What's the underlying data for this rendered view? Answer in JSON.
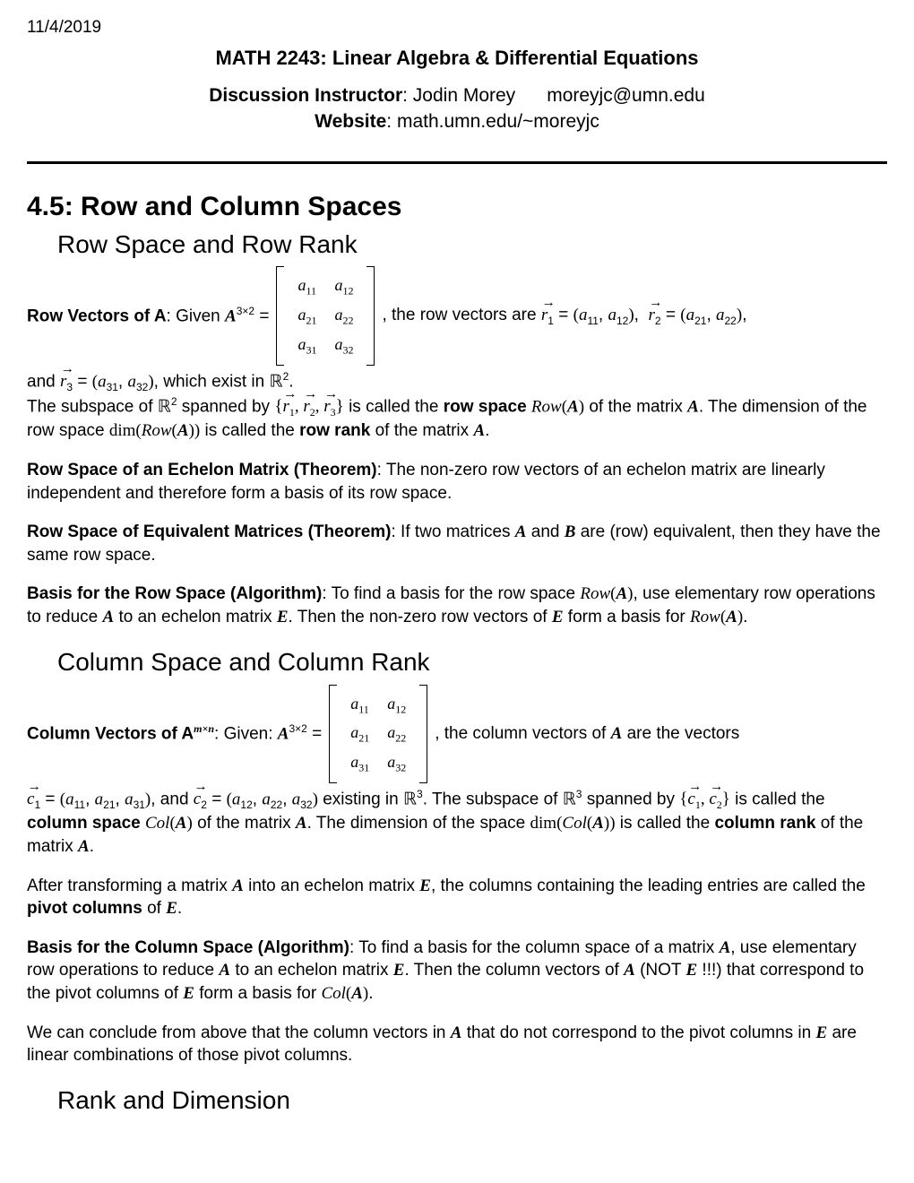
{
  "date": "11/4/2019",
  "course_title": "MATH 2243: Linear Algebra & Differential Equations",
  "instructor_label": "Discussion Instructor",
  "instructor_name": "Jodin Morey",
  "instructor_email": "moreyjc@umn.edu",
  "website_label": "Website",
  "website": "math.umn.edu/~moreyjc",
  "section_number": "4.5:",
  "section_title": "Row and Column Spaces",
  "sub1": "Row Space and Row Rank",
  "rowvec_label": "Row Vectors of A",
  "rowvec_given": ": Given ",
  "rowvec_post": ", the row vectors are ",
  "rowvec_and": "and  ",
  "rowvec_exist": " which exist in ",
  "rowspace_span_pre": "The subspace of ",
  "rowspace_span_mid": " spanned by ",
  "rowspace_span_post": " is called the ",
  "rowspace_bold": "row space",
  "rowspace_of": " of the matrix ",
  "rowspace_dim_pre": " The dimension of the row space ",
  "rowspace_dim_post": " is called the ",
  "rowrank_bold": "row rank",
  "rowrank_of": " of the matrix ",
  "echelon_title": "Row Space of an Echelon Matrix (Theorem)",
  "echelon_body": ":  The non-zero row vectors of an echelon matrix are linearly independent and therefore form a basis of its row space.",
  "equiv_title": "Row Space of Equivalent Matrices (Theorem)",
  "equiv_body_pre": ":  If two matrices ",
  "equiv_body_mid": " and ",
  "equiv_body_post": " are (row) equivalent, then they have the same row space.",
  "rowbasis_title": "Basis for the Row Space (Algorithm)",
  "rowbasis_pre": ": To find a basis for the row space ",
  "rowbasis_mid1": " use elementary row operations to reduce ",
  "rowbasis_mid2": " to an echelon matrix ",
  "rowbasis_mid3": " Then the non-zero row vectors of ",
  "rowbasis_post": " form a basis for ",
  "sub2": "Column Space and Column Rank",
  "colvec_label": "Column Vectors of A",
  "colvec_given": ": Given: ",
  "colvec_post": ", the column vectors of ",
  "colvec_are": " are the vectors ",
  "colvec_and": " and ",
  "colvec_exist": " existing in ",
  "colspace_span_pre": " The subspace of ",
  "colspace_span_mid": " spanned by ",
  "colspace_span_post": " is called the ",
  "colspace_bold": "column space",
  "colspace_of": " of the matrix ",
  "colspace_dim_pre": " The dimension of the space ",
  "colspace_dim_post": " is called the ",
  "colrank_bold": "column rank",
  "colrank_of": " of the matrix ",
  "pivot_pre": "After transforming a matrix ",
  "pivot_mid1": " into an echelon matrix ",
  "pivot_mid2": ", the columns containing the leading entries are called the ",
  "pivot_bold": "pivot columns",
  "pivot_of": " of ",
  "colbasis_title": "Basis for the Column Space (Algorithm)",
  "colbasis_pre": ": To find a basis for the column space of a matrix ",
  "colbasis_mid1": " use elementary row operations to reduce ",
  "colbasis_mid2": " to an echelon matrix ",
  "colbasis_mid3": " Then the column vectors of ",
  "colbasis_not": " (NOT ",
  "colbasis_warn": " !!!) that correspond to the pivot columns of ",
  "colbasis_post": " form a basis for ",
  "conclude_pre": "We can conclude from above that the column vectors in ",
  "conclude_mid": " that do not correspond to the pivot columns in ",
  "conclude_post": " are linear combinations of those pivot columns.",
  "sub3": "Rank and Dimension",
  "matrix_entries": {
    "r1c1": "a",
    "r1c1s": "11",
    "r1c2": "a",
    "r1c2s": "12",
    "r2c1": "a",
    "r2c1s": "21",
    "r2c2": "a",
    "r2c2s": "22",
    "r3c1": "a",
    "r3c1s": "31",
    "r3c2": "a",
    "r3c2s": "32"
  }
}
